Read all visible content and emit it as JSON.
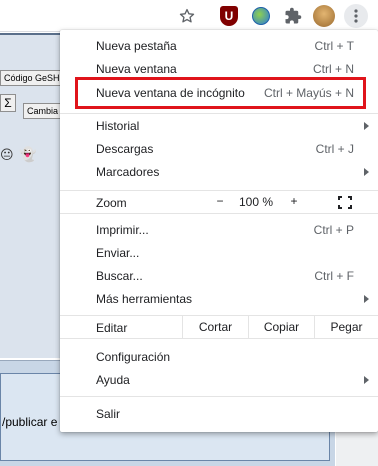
{
  "toolbar": {
    "icons": [
      "star-icon",
      "ublock-icon",
      "globe-extension-icon",
      "puzzle-icon",
      "avatar",
      "kebab-menu-icon"
    ],
    "ublock_letter": "U"
  },
  "page": {
    "geshi_button": "Código GeSHi",
    "sigma_button": "Σ",
    "cambia_button": "Cambia",
    "publicar_text": "/publicar e",
    "emoji_a": "😐",
    "emoji_b": "👻"
  },
  "menu": {
    "new_tab": {
      "label": "Nueva pestaña",
      "shortcut": "Ctrl + T"
    },
    "new_window": {
      "label": "Nueva ventana",
      "shortcut": "Ctrl + N"
    },
    "incognito": {
      "label": "Nueva ventana de incógnito",
      "shortcut": "Ctrl + Mayús + N"
    },
    "history": {
      "label": "Historial"
    },
    "downloads": {
      "label": "Descargas",
      "shortcut": "Ctrl + J"
    },
    "bookmarks": {
      "label": "Marcadores"
    },
    "zoom": {
      "label": "Zoom",
      "minus": "−",
      "value": "100 %",
      "plus": "+"
    },
    "print": {
      "label": "Imprimir...",
      "shortcut": "Ctrl + P"
    },
    "cast": {
      "label": "Enviar..."
    },
    "find": {
      "label": "Buscar...",
      "shortcut": "Ctrl + F"
    },
    "more_tools": {
      "label": "Más herramientas"
    },
    "edit": {
      "label": "Editar",
      "cut": "Cortar",
      "copy": "Copiar",
      "paste": "Pegar"
    },
    "settings": {
      "label": "Configuración"
    },
    "help": {
      "label": "Ayuda"
    },
    "exit": {
      "label": "Salir"
    }
  },
  "colors": {
    "highlight": "#e0141b",
    "accent_ublock": "#800000"
  }
}
